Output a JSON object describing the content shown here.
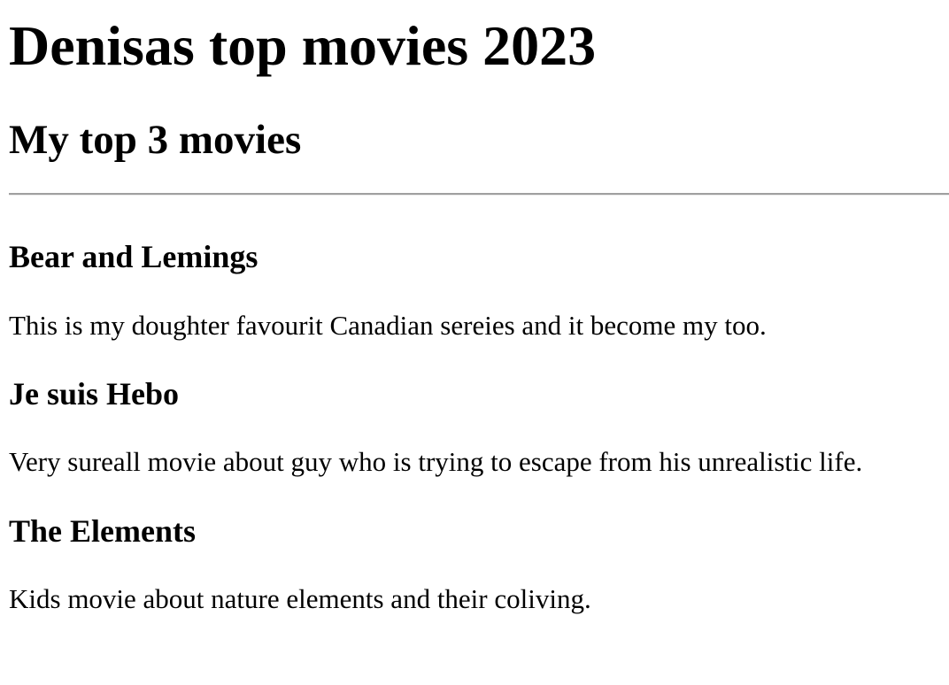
{
  "page": {
    "title": "Denisas top movies 2023",
    "subtitle": "My top 3 movies"
  },
  "movies": [
    {
      "title": "Bear and Lemings",
      "description": "This is my doughter favourit Canadian sereies and it become my too."
    },
    {
      "title": "Je suis Hebo",
      "description": "Very sureall movie about guy who is trying to escape from his unrealistic life."
    },
    {
      "title": "The Elements",
      "description": "Kids movie about nature elements and their coliving."
    }
  ]
}
